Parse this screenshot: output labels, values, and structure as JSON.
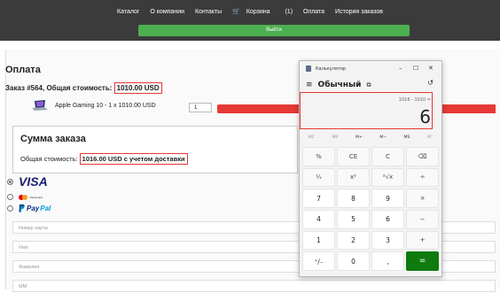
{
  "nav": {
    "items": [
      "Каталог",
      "О компании",
      "Контакты",
      "Корзина",
      "(1)",
      "Оплата",
      "История заказов"
    ],
    "logout": "Выйти"
  },
  "payment": {
    "heading": "Оплата",
    "order_prefix": "Заказ #564, Общая стоимость: ",
    "order_total": "1010.00 USD",
    "product_line": "Apple Gaming 10 - 1 x 1010.00 USD",
    "qty": "1"
  },
  "summary": {
    "title": "Сумма заказа",
    "prefix": "Общая стоимость: ",
    "total": "1016.00 USD с учетом доставки"
  },
  "methods": {
    "visa": "VISA",
    "mastercard": "mastercard",
    "paypal_a": "Pay",
    "paypal_b": "Pal"
  },
  "fields": {
    "card": "Номер карты",
    "name": "Имя",
    "surname": "Фамилия",
    "mm": "ММ"
  },
  "calculator": {
    "window_title": "Калькулятор",
    "mode": "Обычный",
    "expression": "1016 - 1010 =",
    "result": "6",
    "memory": [
      "MC",
      "MR",
      "M+",
      "M−",
      "MS",
      "M˅"
    ],
    "keys": [
      "%",
      "CE",
      "C",
      "⌫",
      "¹⁄ₓ",
      "x²",
      "²√x",
      "÷",
      "7",
      "8",
      "9",
      "×",
      "4",
      "5",
      "6",
      "−",
      "1",
      "2",
      "3",
      "+",
      "⁺∕₋",
      "0",
      ",",
      "="
    ]
  },
  "colors": {
    "topbar": "#3b3b3b",
    "logout": "#4caf50",
    "highlight": "#e53935",
    "equals": "#0f7b0f"
  }
}
